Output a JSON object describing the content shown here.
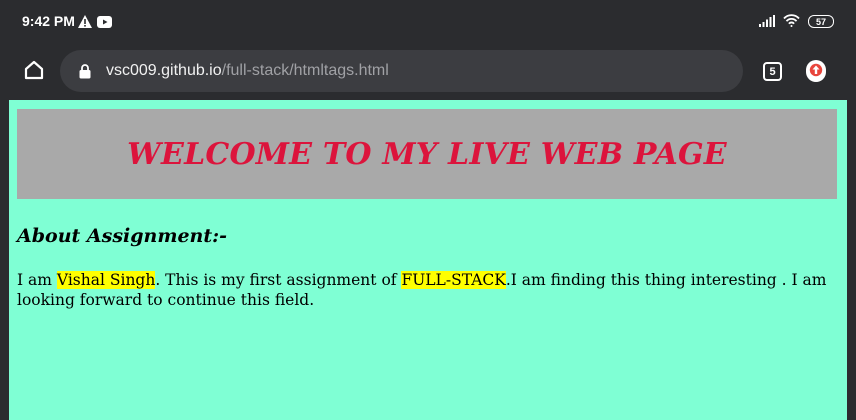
{
  "status_bar": {
    "time": "9:42 PM",
    "left_icons": [
      "alert-triangle-icon",
      "youtube-icon"
    ],
    "right_icons": [
      "signal-icon",
      "wifi-icon"
    ],
    "battery": "57"
  },
  "browser": {
    "home_icon": "home-icon",
    "lock_icon": "lock-icon",
    "url_host": "vsc009.github.io",
    "url_path": "/full-stack/htmltags.html",
    "tab_count": "5",
    "update_icon": "update-arrow-icon"
  },
  "page": {
    "banner_title": "WELCOME TO MY LIVE WEB PAGE",
    "about_heading": "About Assignment:-",
    "about_text": {
      "part1": "I am ",
      "name": "Vishal Singh",
      "part2": ". This is my first assignment of ",
      "course": "FULL-STACK",
      "part3": ".I am finding this thing interesting . I am looking forward to continue this field."
    },
    "colors": {
      "background": "#7fffd4",
      "banner_bg": "#a9a9a9",
      "title": "#dc143c",
      "highlight": "#ffff00"
    }
  }
}
